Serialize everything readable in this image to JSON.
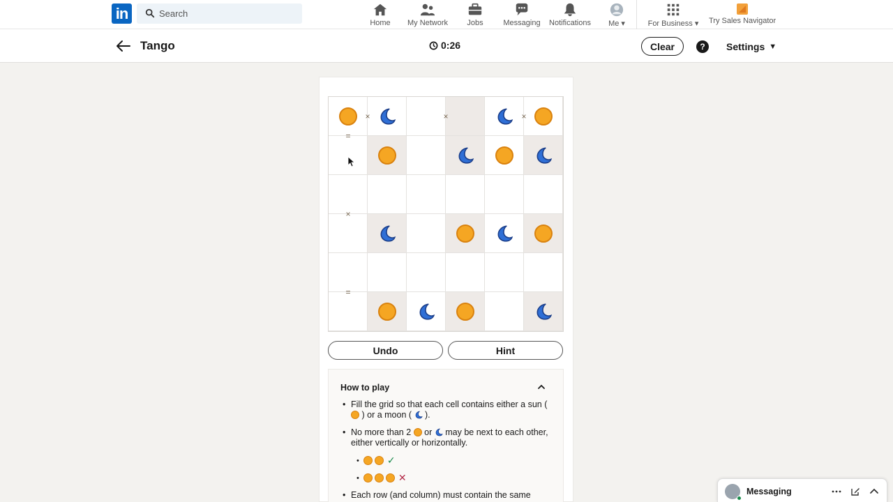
{
  "nav": {
    "search_placeholder": "Search",
    "items": [
      {
        "label": "Home"
      },
      {
        "label": "My Network"
      },
      {
        "label": "Jobs"
      },
      {
        "label": "Messaging"
      },
      {
        "label": "Notifications"
      },
      {
        "label": "Me"
      },
      {
        "label": "For Business"
      },
      {
        "label": "Try Sales Navigator"
      }
    ]
  },
  "game": {
    "title": "Tango",
    "timer": "0:26",
    "clear_label": "Clear",
    "help_label": "?",
    "settings_label": "Settings",
    "undo_label": "Undo",
    "hint_label": "Hint",
    "grid": [
      [
        "sun",
        "moon",
        "",
        "",
        "moon",
        "sun"
      ],
      [
        "",
        "sun",
        "",
        "moon",
        "sun",
        "moon"
      ],
      [
        "",
        "",
        "",
        "",
        "",
        ""
      ],
      [
        "",
        "moon",
        "",
        "sun",
        "moon",
        "sun"
      ],
      [
        "",
        "",
        "",
        "",
        "",
        ""
      ],
      [
        "",
        "sun",
        "moon",
        "sun",
        "",
        "moon"
      ]
    ],
    "locked": [
      [
        false,
        false,
        false,
        true,
        false,
        false
      ],
      [
        false,
        true,
        false,
        true,
        false,
        true
      ],
      [
        false,
        false,
        false,
        false,
        false,
        false
      ],
      [
        false,
        true,
        false,
        true,
        false,
        true
      ],
      [
        false,
        false,
        false,
        false,
        false,
        false
      ],
      [
        false,
        true,
        false,
        true,
        false,
        true
      ]
    ],
    "constraints": [
      {
        "symbol": "×",
        "row": 0,
        "col": 0,
        "dir": "right"
      },
      {
        "symbol": "×",
        "row": 0,
        "col": 2,
        "dir": "right"
      },
      {
        "symbol": "×",
        "row": 0,
        "col": 4,
        "dir": "right"
      },
      {
        "symbol": "=",
        "row": 0,
        "col": 0,
        "dir": "down"
      },
      {
        "symbol": "×",
        "row": 2,
        "col": 0,
        "dir": "down"
      },
      {
        "symbol": "=",
        "row": 4,
        "col": 0,
        "dir": "down"
      }
    ]
  },
  "howto": {
    "title": "How to play",
    "rule1_a": "Fill the grid so that each cell contains either a sun (",
    "rule1_b": ") or a moon (",
    "rule1_c": ").",
    "rule2_a": "No more than 2",
    "rule2_b": "or",
    "rule2_c": "may be next to each other, either vertically or horizontally.",
    "example_ok": "✓",
    "example_bad": "✕",
    "rule3": "Each row (and column) must contain the same"
  },
  "messaging": {
    "label": "Messaging"
  },
  "colors": {
    "brand": "#0a66c2",
    "sun": "#f5a623",
    "moon": "#2f6fd6",
    "check": "#1a8b4c",
    "cross": "#b42d4a"
  }
}
